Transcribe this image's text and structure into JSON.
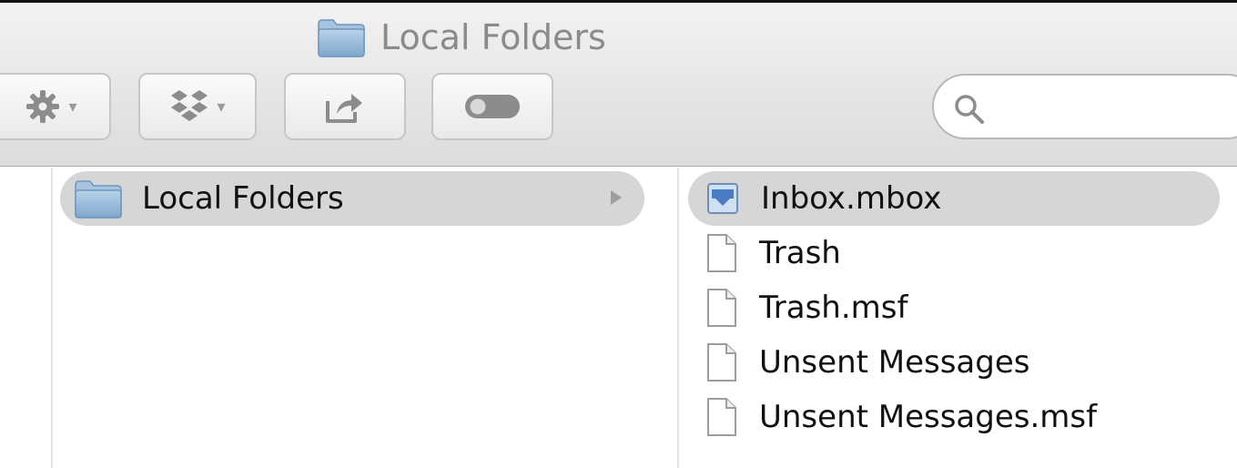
{
  "window": {
    "title": "Local Folders",
    "title_icon": "folder-icon"
  },
  "toolbar": {
    "buttons": [
      {
        "name": "action",
        "icon": "gear-icon",
        "has_menu": true
      },
      {
        "name": "dropbox",
        "icon": "dropbox-icon",
        "has_menu": true
      },
      {
        "name": "share",
        "icon": "share-icon",
        "has_menu": false
      },
      {
        "name": "tags",
        "icon": "toggle-icon",
        "has_menu": false
      }
    ],
    "caret": "▾",
    "search": {
      "placeholder": "",
      "value": "",
      "icon": "search-icon"
    }
  },
  "columns": {
    "left": {
      "items": [
        {
          "label": "Local Folders",
          "icon": "folder-icon",
          "selected": true,
          "has_children": true
        }
      ]
    },
    "right": {
      "items": [
        {
          "label": "Inbox.mbox",
          "icon": "mailbox-icon",
          "selected": true
        },
        {
          "label": "Trash",
          "icon": "document-icon",
          "selected": false
        },
        {
          "label": "Trash.msf",
          "icon": "document-icon",
          "selected": false
        },
        {
          "label": "Unsent Messages",
          "icon": "document-icon",
          "selected": false
        },
        {
          "label": "Unsent Messages.msf",
          "icon": "document-icon",
          "selected": false
        }
      ]
    }
  },
  "colors": {
    "selection": "#d6d6d6",
    "title_text": "#8b8b8b",
    "folder_blue": "#8fb6d8"
  }
}
